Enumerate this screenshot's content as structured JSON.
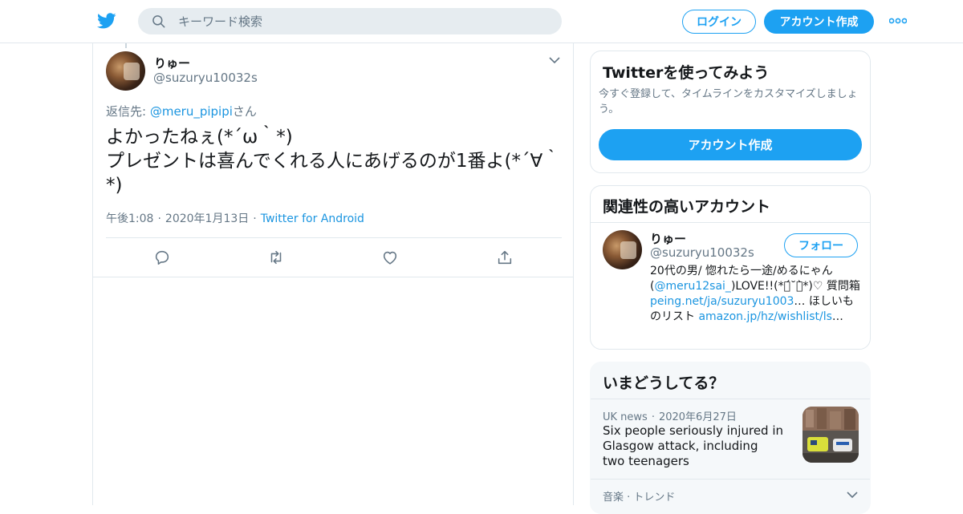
{
  "topbar": {
    "logo": "twitter-bird-icon",
    "search_placeholder": "キーワード検索",
    "login_label": "ログイン",
    "signup_label": "アカウント作成",
    "more_icon": "more-dots-icon"
  },
  "tweet": {
    "author_name": "りゅー",
    "author_handle": "@suzuryu10032s",
    "reply_prefix": "返信先: ",
    "reply_mention": "@meru_pipipi",
    "reply_suffix": "さん",
    "text": "よかったねぇ(*´ω｀*)\nプレゼントは喜んでくれる人にあげるのが1番よ(*´∀｀*)",
    "time": "午後1:08",
    "date": "2020年1月13日",
    "source": "Twitter for Android",
    "actions": [
      "reply-icon",
      "retweet-icon",
      "like-icon",
      "share-icon"
    ]
  },
  "signup_card": {
    "title": "Twitterを使ってみよう",
    "description": "今すぐ登録して、タイムラインをカスタマイズしましょう。",
    "button_label": "アカウント作成"
  },
  "related": {
    "title": "関連性の高いアカウント",
    "name": "りゅー",
    "handle": "@suzuryu10032s",
    "follow_label": "フォロー",
    "bio_1": "20代の男/ 惚れたら一途/めるにゃん(",
    "bio_mention": "@meru12sai_",
    "bio_2": ")LOVE!!(*ฅ́˘ฅ̀*)♡ 質問箱 ",
    "bio_link1": "peing.net/ja/suzuryu1003",
    "bio_3": "… ほしいものリスト ",
    "bio_link2": "amazon.jp/hz/wishlist/ls",
    "bio_4": "…"
  },
  "trends": {
    "title": "いまどうしてる？",
    "news_source": "UK news",
    "news_date": "2020年6月27日",
    "news_title": "Six people seriously injured in Glasgow attack, including two teenagers",
    "next_category": "音楽 · トレンド"
  },
  "colors": {
    "accent": "#1da1f2",
    "link": "#1b95e0",
    "muted": "#657786",
    "border": "#e1e8ed"
  }
}
